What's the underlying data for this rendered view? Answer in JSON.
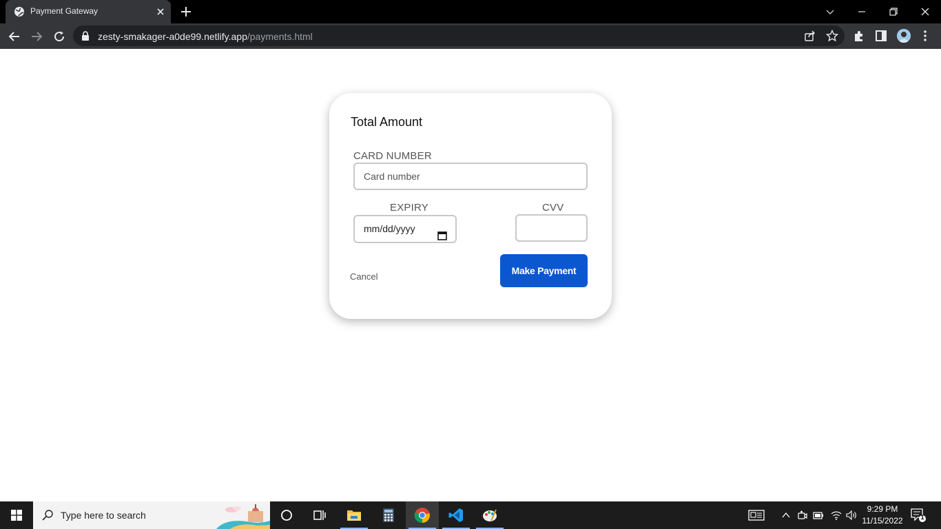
{
  "browser": {
    "tab_title": "Payment Gateway",
    "url_host": "zesty-smakager-a0de99.netlify.app",
    "url_path": "/payments.html",
    "icons": [
      "globe-icon",
      "close-icon",
      "plus-icon",
      "chevron-down-icon",
      "minimize-icon",
      "restore-icon",
      "window-close-icon",
      "back-arrow-icon",
      "forward-arrow-icon",
      "reload-icon",
      "lock-icon",
      "share-icon",
      "star-icon",
      "extensions-icon",
      "side-panel-icon",
      "profile-avatar",
      "kebab-menu-icon"
    ]
  },
  "payment_form": {
    "title": "Total Amount",
    "card_number_label": "CARD NUMBER",
    "card_number_placeholder": "Card number",
    "expiry_label": "EXPIRY",
    "expiry_placeholder": "mm/dd/yyyy",
    "cvv_label": "CVV",
    "cancel_label": "Cancel",
    "pay_label": "Make Payment"
  },
  "taskbar": {
    "search_placeholder": "Type here to search",
    "time": "9:29 PM",
    "date": "11/15/2022",
    "notification_count": "1",
    "apps": [
      "cortana-icon",
      "task-view-icon",
      "file-explorer-icon",
      "calculator-icon",
      "chrome-icon",
      "vscode-icon",
      "paint-icon"
    ]
  },
  "colors": {
    "pay_button": "#0b57d0",
    "tab_bar": "#000000",
    "toolbar": "#35363a",
    "taskbar": "#1c1c1c"
  }
}
